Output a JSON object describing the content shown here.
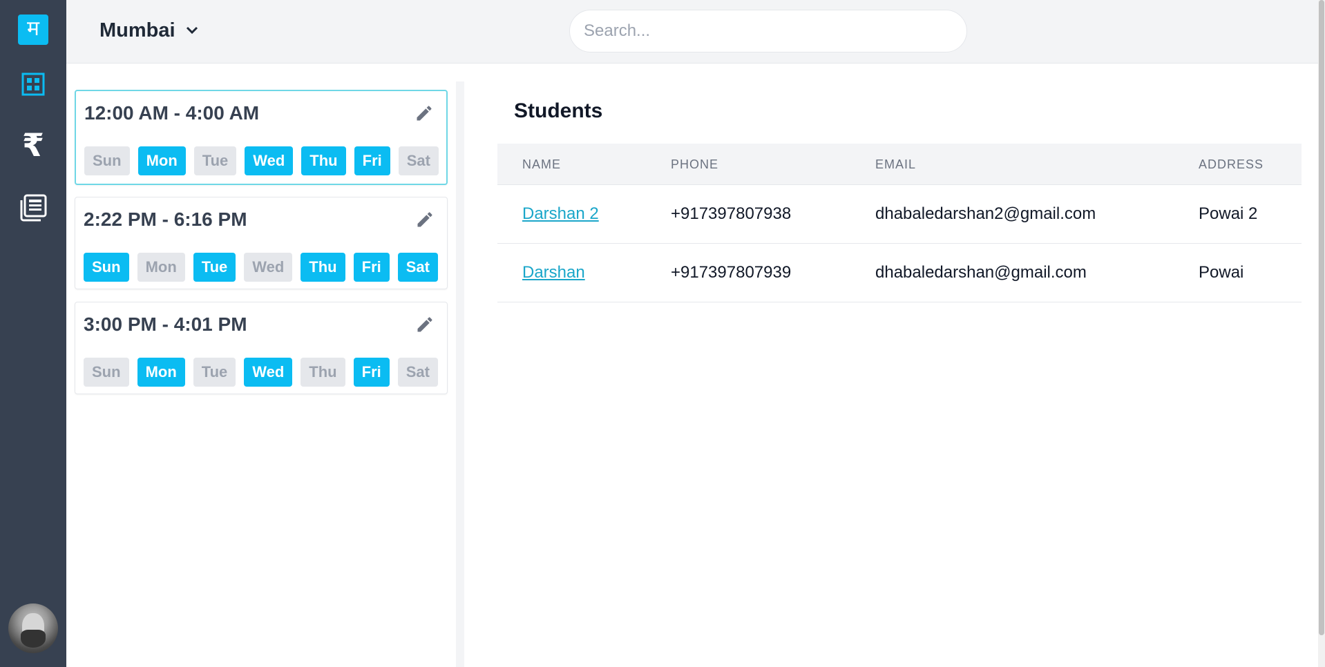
{
  "brand": {
    "logo_glyph": "म",
    "accent": "#0bbcf2"
  },
  "sidebar": {
    "items": [
      {
        "icon": "dashboard-icon"
      },
      {
        "icon": "rupee-icon",
        "glyph": "₹"
      },
      {
        "icon": "newspaper-icon"
      }
    ],
    "avatar": "user-avatar"
  },
  "header": {
    "city": "Mumbai",
    "search_placeholder": "Search..."
  },
  "slots": [
    {
      "time": "12:00 AM - 4:00 AM",
      "selected": true,
      "days": [
        {
          "label": "Sun",
          "active": false
        },
        {
          "label": "Mon",
          "active": true
        },
        {
          "label": "Tue",
          "active": false
        },
        {
          "label": "Wed",
          "active": true
        },
        {
          "label": "Thu",
          "active": true
        },
        {
          "label": "Fri",
          "active": true
        },
        {
          "label": "Sat",
          "active": false
        }
      ]
    },
    {
      "time": "2:22 PM - 6:16 PM",
      "selected": false,
      "days": [
        {
          "label": "Sun",
          "active": true
        },
        {
          "label": "Mon",
          "active": false
        },
        {
          "label": "Tue",
          "active": true
        },
        {
          "label": "Wed",
          "active": false
        },
        {
          "label": "Thu",
          "active": true
        },
        {
          "label": "Fri",
          "active": true
        },
        {
          "label": "Sat",
          "active": true
        }
      ]
    },
    {
      "time": "3:00 PM - 4:01 PM",
      "selected": false,
      "days": [
        {
          "label": "Sun",
          "active": false
        },
        {
          "label": "Mon",
          "active": true
        },
        {
          "label": "Tue",
          "active": false
        },
        {
          "label": "Wed",
          "active": true
        },
        {
          "label": "Thu",
          "active": false
        },
        {
          "label": "Fri",
          "active": true
        },
        {
          "label": "Sat",
          "active": false
        }
      ]
    }
  ],
  "students": {
    "title": "Students",
    "columns": [
      "NAME",
      "PHONE",
      "EMAIL",
      "ADDRESS"
    ],
    "rows": [
      {
        "name": "Darshan 2",
        "phone": "+917397807938",
        "email": "dhabaledarshan2@gmail.com",
        "address": "Powai 2"
      },
      {
        "name": "Darshan",
        "phone": "+917397807939",
        "email": "dhabaledarshan@gmail.com",
        "address": "Powai"
      }
    ]
  }
}
